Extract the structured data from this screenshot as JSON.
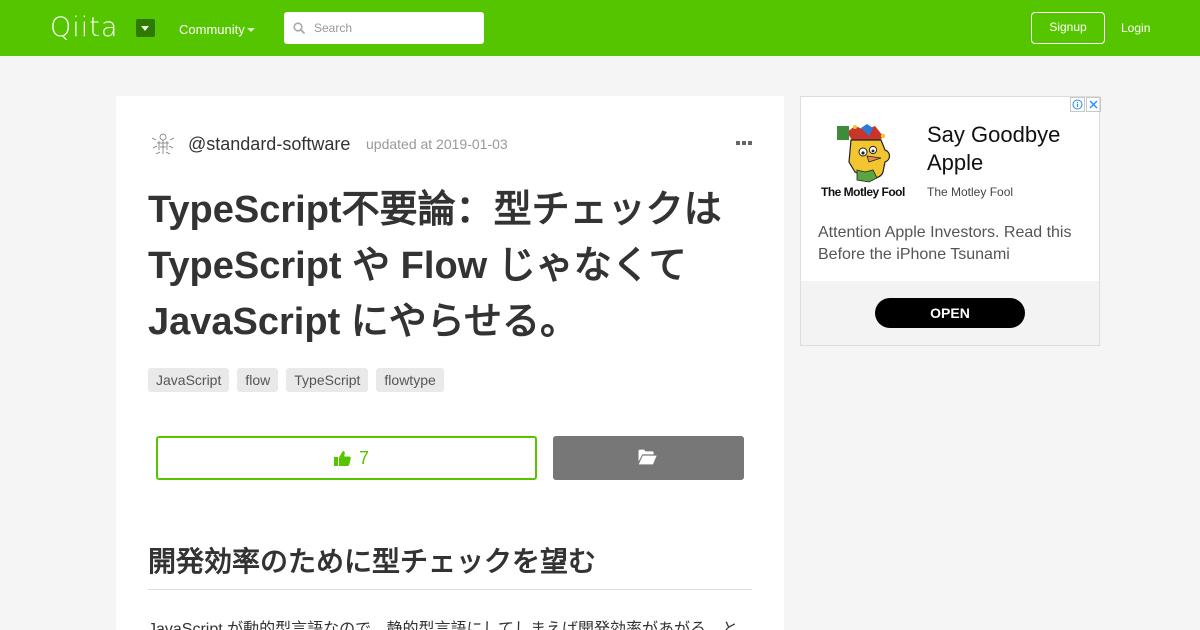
{
  "header": {
    "logo_text": "Qiita",
    "community_label": "Community",
    "search_placeholder": "Search",
    "signup_label": "Signup",
    "login_label": "Login",
    "brand_color": "#55c500"
  },
  "article": {
    "author": "@standard-software",
    "updated": "updated at 2019-01-03",
    "title": "TypeScript不要論：型チェックは TypeScript や Flow じゃなくて JavaScript にやらせる。",
    "tags": [
      "JavaScript",
      "flow",
      "TypeScript",
      "flowtype"
    ],
    "like_count": "7",
    "section_heading": "開発効率のために型チェックを望む",
    "paragraph": "JavaScript が動的型言語なので、静的型言語にしてしまえば開発効率があがる、と"
  },
  "ad": {
    "brand_logo_text": "The Motley Fool",
    "headline": "Say Goodbye Apple",
    "source": "The Motley Fool",
    "body": "Attention Apple Investors. Read this Before the iPhone Tsunami",
    "cta": "OPEN"
  }
}
